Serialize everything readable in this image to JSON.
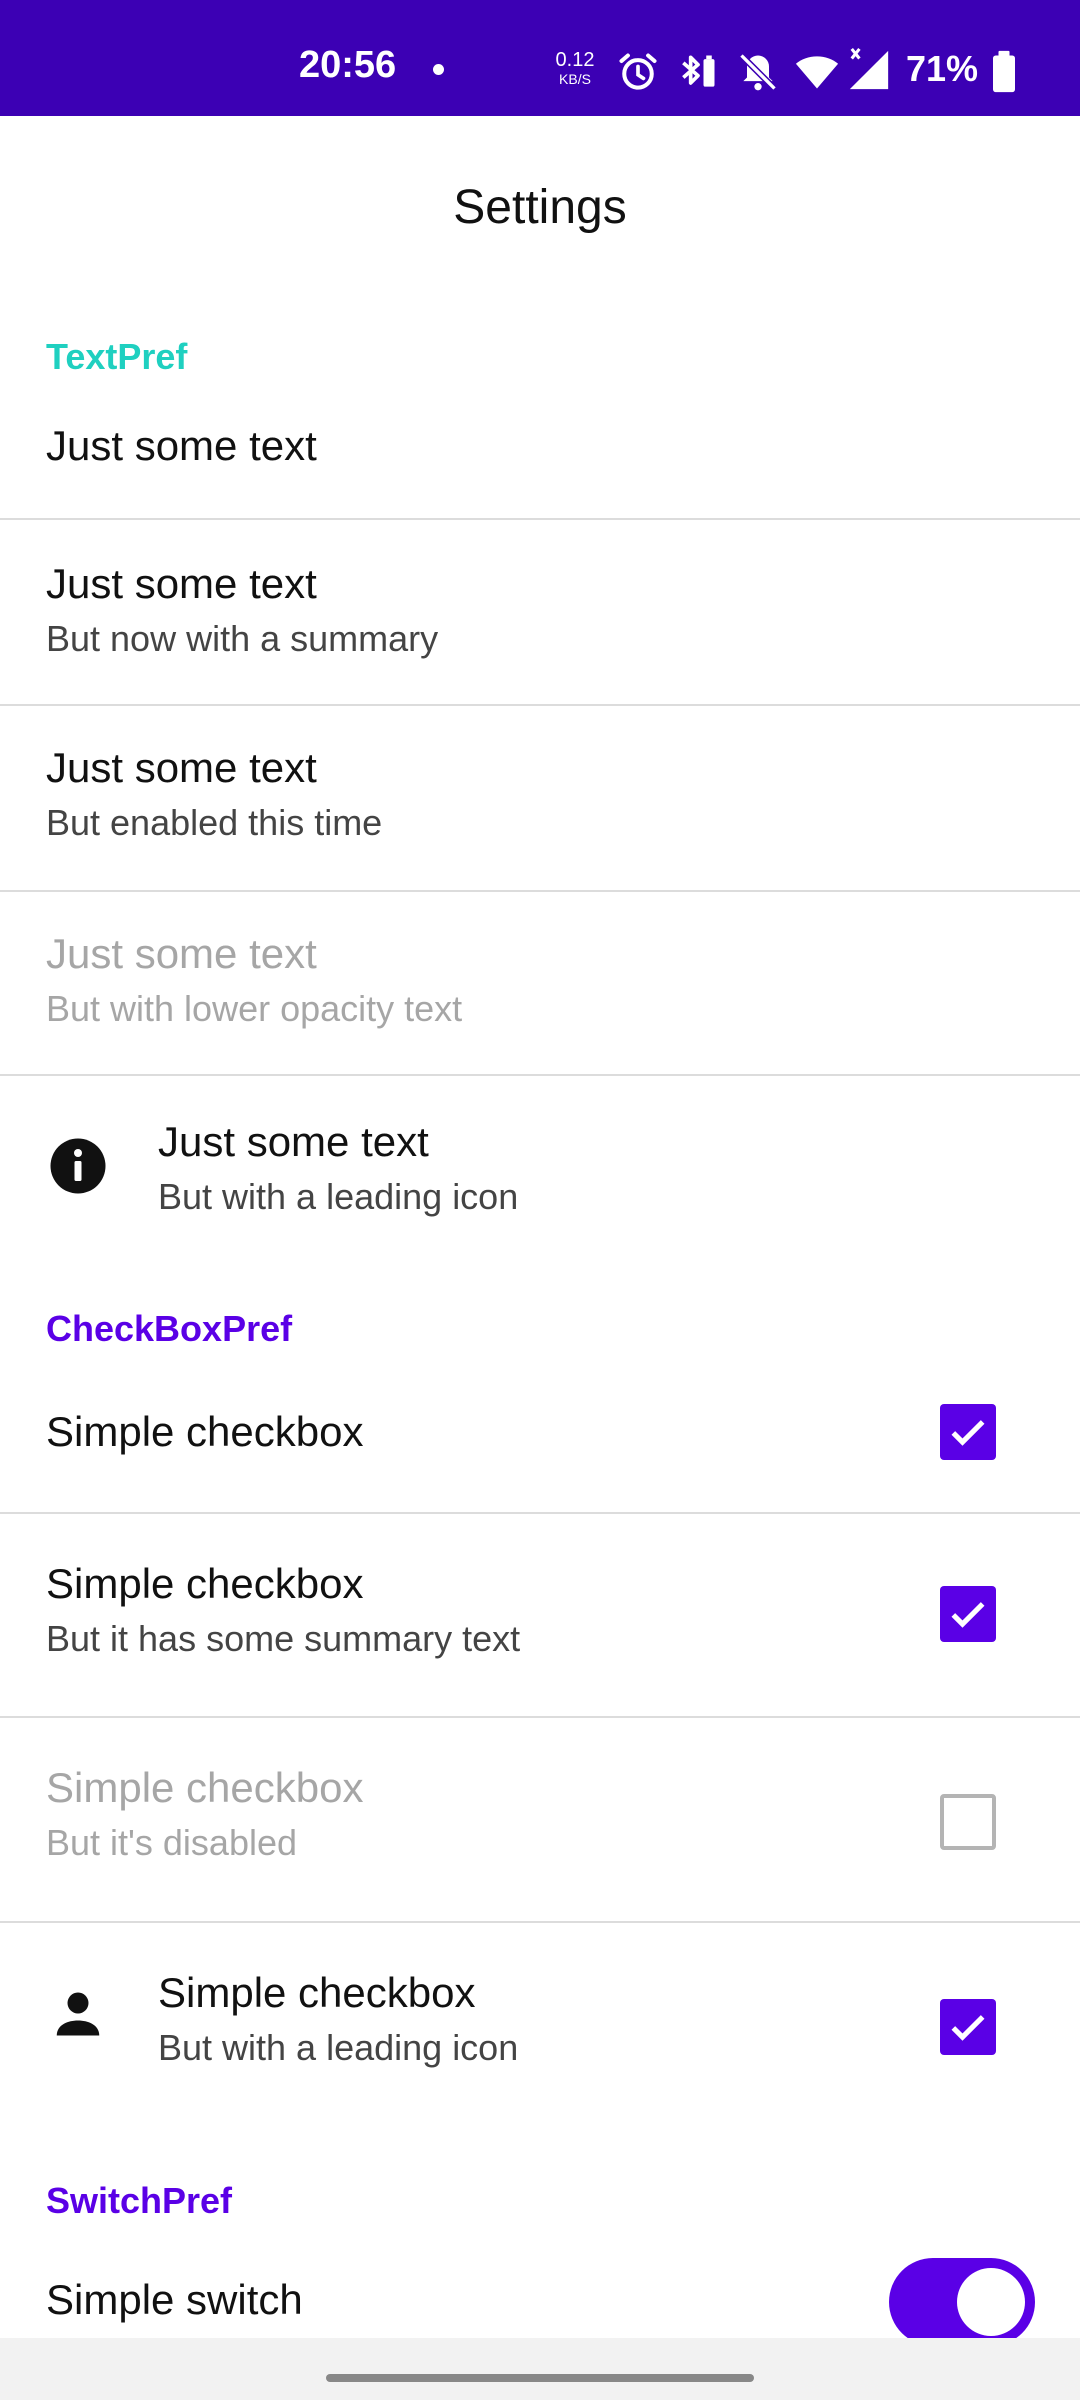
{
  "status_bar": {
    "time": "20:56",
    "net_speed_value": "0.12",
    "net_speed_unit": "KB/S",
    "battery_percent": "71%",
    "icons": [
      "alarm-icon",
      "bluetooth-battery-icon",
      "notifications-off-icon",
      "wifi-icon",
      "signal-icon",
      "battery-icon"
    ]
  },
  "app_bar": {
    "title": "Settings"
  },
  "colors": {
    "status_bar": "#3c00b4",
    "accent": "#5a00e6",
    "textpref_header": "#1fd0c0",
    "header": "#5a00e6"
  },
  "sections": {
    "text": {
      "header": "TextPref",
      "items": [
        {
          "title": "Just some text"
        },
        {
          "title": "Just some text",
          "summary": "But now with a summary"
        },
        {
          "title": "Just some text",
          "summary": "But enabled this time"
        },
        {
          "title": "Just some text",
          "summary": "But with lower opacity text"
        },
        {
          "title": "Just some text",
          "summary": "But with a leading icon",
          "icon": "info-icon"
        }
      ]
    },
    "checkbox": {
      "header": "CheckBoxPref",
      "items": [
        {
          "title": "Simple checkbox",
          "checked": true
        },
        {
          "title": "Simple checkbox",
          "summary": "But it has some summary text",
          "checked": true
        },
        {
          "title": "Simple checkbox",
          "summary": "But it's disabled",
          "checked": false,
          "enabled": false
        },
        {
          "title": "Simple checkbox",
          "summary": "But with a leading icon",
          "checked": true,
          "icon": "person-icon"
        }
      ]
    },
    "switch": {
      "header": "SwitchPref",
      "items": [
        {
          "title": "Simple switch",
          "on": true
        }
      ]
    }
  }
}
